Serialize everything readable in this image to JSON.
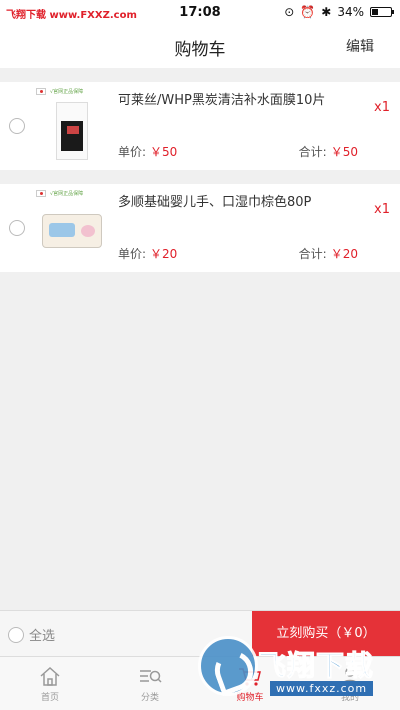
{
  "status_bar": {
    "watermark": "飞翔下载 www.FXXZ.com",
    "time": "17:08",
    "battery": "34%",
    "battery_level": 0.34
  },
  "header": {
    "title": "购物车",
    "edit_label": "编辑"
  },
  "cart": {
    "unit_price_label": "单价:",
    "subtotal_label": "合计:",
    "items": [
      {
        "name": "可莱丝/WHP黑炭清洁补水面膜10片",
        "quantity": "x1",
        "unit_price": "￥50",
        "subtotal": "￥50",
        "thumb_tag": "√官网正品保障",
        "thumb_icon": "face-mask-product-image"
      },
      {
        "name": "多顺基础婴儿手、口湿巾棕色80P",
        "quantity": "x1",
        "unit_price": "￥20",
        "subtotal": "￥20",
        "thumb_tag": "√官网正品保障",
        "thumb_icon": "baby-wipes-product-image"
      }
    ]
  },
  "checkout": {
    "select_all_label": "全选",
    "buy_button_label": "立刻购买（￥0）"
  },
  "tabbar": {
    "tabs": [
      {
        "label": "首页",
        "icon": "home-icon"
      },
      {
        "label": "分类",
        "icon": "category-icon"
      },
      {
        "label": "购物车",
        "icon": "cart-icon",
        "active": true
      },
      {
        "label": "我的",
        "icon": "user-icon"
      }
    ]
  },
  "brand_watermark": {
    "title": "飞翔下载",
    "url": "www.fxxz.com"
  },
  "colors": {
    "accent": "#e53238",
    "price": "#e0202a"
  }
}
